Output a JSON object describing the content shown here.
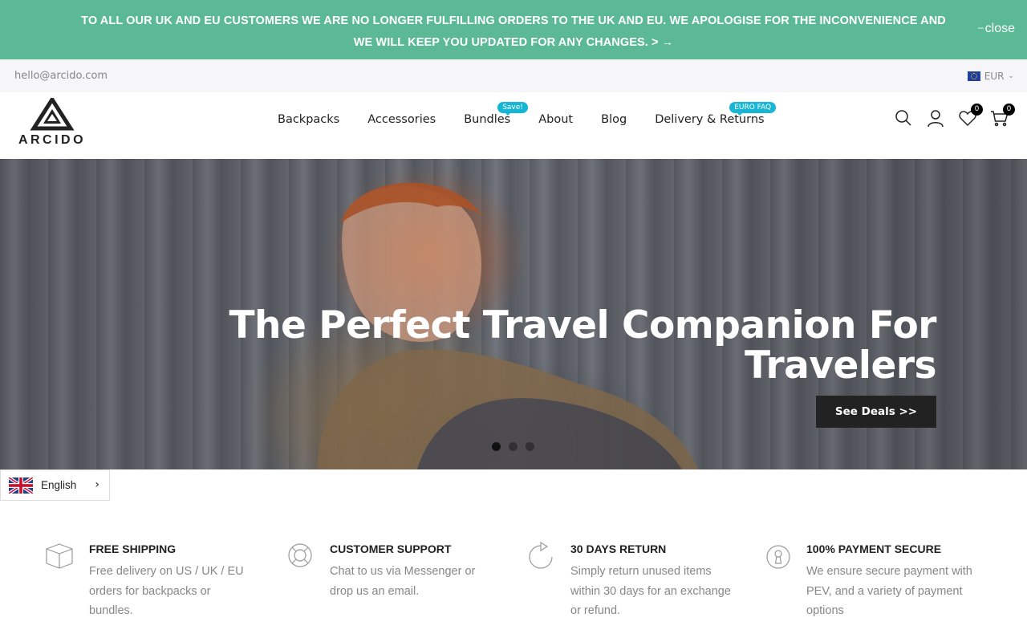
{
  "announcement": {
    "text": "TO ALL OUR UK AND EU CUSTOMERS WE ARE NO LONGER FULFILLING ORDERS TO THE UK AND EU. WE APOLOGISE FOR THE INCONVENIENCE AND WE WILL KEEP YOU UPDATED FOR ANY CHANGES. >",
    "arrow": "→",
    "close_label": "close",
    "background": "#5cb995"
  },
  "topbar": {
    "email": "hello@arcido.com",
    "currency": "EUR",
    "currency_flag_icon": "eu-flag-icon"
  },
  "header": {
    "logo_text": "ARCIDO",
    "nav": [
      {
        "label": "Backpacks"
      },
      {
        "label": "Accessories"
      },
      {
        "label": "Bundles",
        "badge": "Save!"
      },
      {
        "label": "About"
      },
      {
        "label": "Blog"
      },
      {
        "label": "Delivery & Returns",
        "badge": "EURO FAQ"
      }
    ],
    "icons": {
      "search": "search-icon",
      "account": "user-icon",
      "wishlist": "heart-icon",
      "cart": "cart-icon"
    },
    "wishlist_count": "0",
    "cart_count": "0",
    "badge_color": "#17b6d4"
  },
  "hero": {
    "title": "The Perfect Travel Companion For Travelers",
    "button_label": "See Deals >>",
    "slide_count": 3,
    "active_slide": 1
  },
  "language": {
    "label": "English",
    "flag_icon": "uk-flag-icon"
  },
  "features": [
    {
      "title": "FREE SHIPPING",
      "description": "Free delivery on US / UK / EU orders for backpacks or bundles.",
      "icon": "box-icon"
    },
    {
      "title": "CUSTOMER SUPPORT",
      "description": "Chat to us via Messenger or drop us an email.",
      "icon": "lifebuoy-icon"
    },
    {
      "title": "30 DAYS RETURN",
      "description": "Simply return unused items within 30 days for an exchange or refund.",
      "icon": "refresh-icon"
    },
    {
      "title": "100% PAYMENT SECURE",
      "description": "We ensure secure payment with PEV, and a variety of payment options",
      "icon": "keyhole-icon"
    }
  ]
}
